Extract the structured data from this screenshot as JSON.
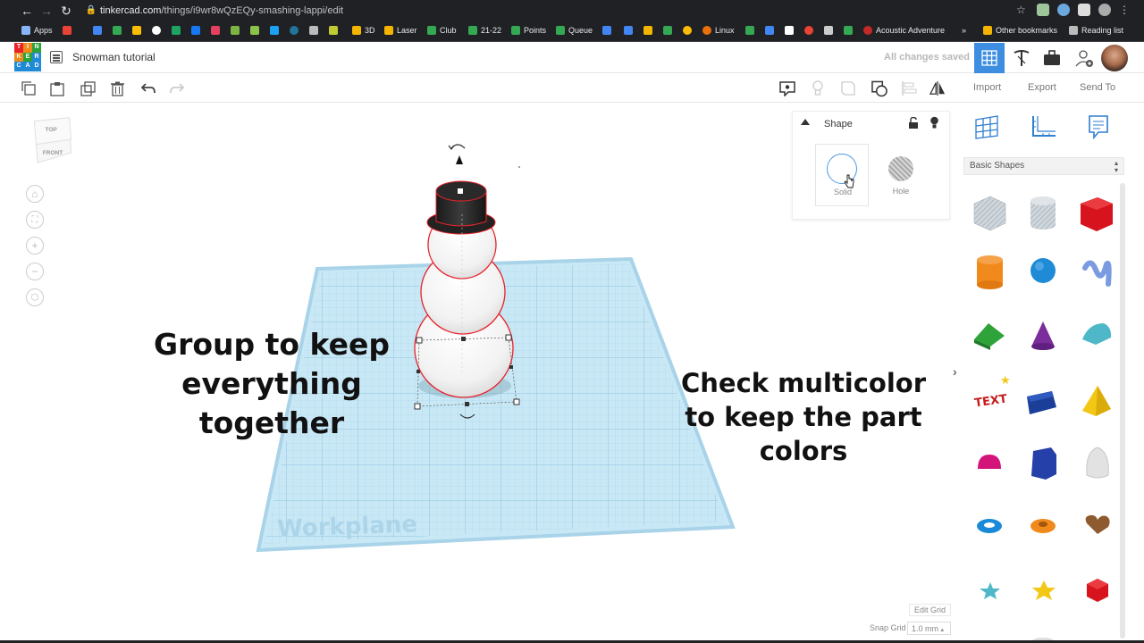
{
  "browser": {
    "url_host": "tinkercad.com",
    "url_path": "/things/i9wr8wQzEQy-smashing-lappi/edit",
    "bookmarks": [
      "Apps",
      "3D",
      "Laser",
      "Club",
      "21-22",
      "Points",
      "Queue",
      "Linux",
      "Acoustic Adventure",
      "Other bookmarks",
      "Reading list"
    ],
    "overflow": "»"
  },
  "header": {
    "logo_letters": [
      "T",
      "I",
      "N",
      "K",
      "E",
      "R",
      "C",
      "A",
      "D"
    ],
    "title": "Snowman tutorial",
    "save_status": "All changes saved"
  },
  "right_toolbar": {
    "import": "Import",
    "export": "Export",
    "send_to": "Send To"
  },
  "viewcube": {
    "top": "TOP",
    "front": "FRONT"
  },
  "shape_panel": {
    "title": "Shape",
    "solid_label": "Solid",
    "hole_label": "Hole"
  },
  "overlay": {
    "left_lines": [
      "Group to keep",
      "everything",
      "together"
    ],
    "right_lines": [
      "Check multicolor",
      "to keep the part",
      "colors"
    ]
  },
  "workplane_label": "Workplane",
  "shapes_library": {
    "category": "Basic Shapes",
    "shapes": [
      {
        "name": "box-hole",
        "color": "#b9c3cc"
      },
      {
        "name": "cylinder-hole",
        "color": "#b9c3cc"
      },
      {
        "name": "box",
        "color": "#d7131d"
      },
      {
        "name": "cylinder",
        "color": "#f08a1d"
      },
      {
        "name": "sphere",
        "color": "#1f8ad6"
      },
      {
        "name": "scribble",
        "color": "#7a9be0"
      },
      {
        "name": "roof",
        "color": "#2ea33a"
      },
      {
        "name": "cone",
        "color": "#7b2d9b"
      },
      {
        "name": "round-roof",
        "color": "#4fb8c8"
      },
      {
        "name": "text",
        "color": "#c41c1c"
      },
      {
        "name": "wedge",
        "color": "#1b3f99"
      },
      {
        "name": "pyramid",
        "color": "#f2c716"
      },
      {
        "name": "half-sphere",
        "color": "#d3157a"
      },
      {
        "name": "polygon",
        "color": "#2540a8"
      },
      {
        "name": "paraboloid",
        "color": "#dcdcdc"
      },
      {
        "name": "torus",
        "color": "#1a8ad8"
      },
      {
        "name": "tube",
        "color": "#f08a1d"
      },
      {
        "name": "heart",
        "color": "#8e5a2f"
      },
      {
        "name": "star",
        "color": "#4fb8c8"
      },
      {
        "name": "star-gold",
        "color": "#f2c716"
      },
      {
        "name": "icosahedron",
        "color": "#d7131d"
      }
    ]
  },
  "grid": {
    "edit_grid": "Edit Grid",
    "snap_grid": "Snap Grid",
    "snap_value": "1.0 mm"
  },
  "colors": {
    "accent": "#3d8de0",
    "workplane": "#bfe2f2",
    "selection": "#e8232a"
  }
}
